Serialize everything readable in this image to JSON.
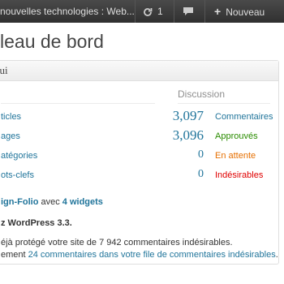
{
  "adminbar": {
    "site_name": "nouvelles technologies : Web...",
    "updates_count": "1",
    "new_label": "Nouveau",
    "icons": {
      "updates": "refresh-icon",
      "comments": "speech-bubble-icon",
      "new": "plus-icon"
    }
  },
  "page": {
    "title": "leau de bord"
  },
  "widget": {
    "title": "hui",
    "discussion_header": "Discussion",
    "content_rows": [
      "ticles",
      "ages",
      "atégories",
      "ots-clefs"
    ],
    "discussion_rows": [
      {
        "count": "3,097",
        "label": "Commentaires",
        "color": "#21759b"
      },
      {
        "count": "3,096",
        "label": "Approuvés",
        "color": "#2a8c00"
      },
      {
        "count": "0",
        "label": "En attente",
        "color": "#e66f00"
      },
      {
        "count": "0",
        "label": "Indésirables",
        "color": "#e00000"
      }
    ],
    "theme_line": {
      "theme_name": "ign-Folio",
      "text_with": " avec ",
      "widgets_link": "4 widgets"
    },
    "version_line": "z WordPress 3.3.",
    "akismet_line1": "éjà protégé votre site de 7 942 commentaires indésirables.",
    "akismet_line2_prefix": "ement ",
    "akismet_line2_link": "24 commentaires dans votre file de commentaires indésirables",
    "akismet_line2_suffix": "."
  }
}
